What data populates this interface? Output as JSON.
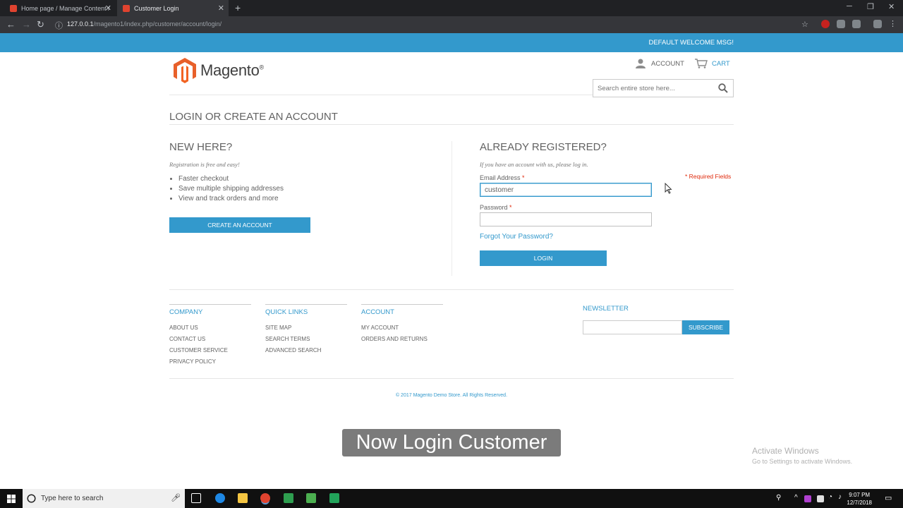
{
  "browser": {
    "tabs": [
      {
        "title": "Home page / Manage Content /"
      },
      {
        "title": "Customer Login"
      }
    ],
    "url_host": "127.0.0.1",
    "url_path": "/magento1/index.php/customer/account/login/"
  },
  "header": {
    "welcome": "DEFAULT WELCOME MSG!",
    "logo_text": "Magento",
    "account_label": "ACCOUNT",
    "cart_label": "CART",
    "search_placeholder": "Search entire store here..."
  },
  "page": {
    "title": "LOGIN OR CREATE AN ACCOUNT",
    "new_customer": {
      "heading": "NEW HERE?",
      "subtitle": "Registration is free and easy!",
      "benefits": [
        "Faster checkout",
        "Save multiple shipping addresses",
        "View and track orders and more"
      ],
      "button": "CREATE AN ACCOUNT"
    },
    "registered": {
      "heading": "ALREADY REGISTERED?",
      "subtitle": "If you have an account with us, please log in.",
      "required_note": "* Required Fields",
      "email_label": "Email Address",
      "email_value": "customer",
      "password_label": "Password",
      "required_mark": "*",
      "forgot_link": "Forgot Your Password?",
      "login_button": "LOGIN"
    }
  },
  "footer": {
    "columns": [
      {
        "title": "COMPANY",
        "links": [
          "ABOUT US",
          "CONTACT US",
          "CUSTOMER SERVICE",
          "PRIVACY POLICY"
        ]
      },
      {
        "title": "QUICK LINKS",
        "links": [
          "SITE MAP",
          "SEARCH TERMS",
          "ADVANCED SEARCH"
        ]
      },
      {
        "title": "ACCOUNT",
        "links": [
          "MY ACCOUNT",
          "ORDERS AND RETURNS"
        ]
      }
    ],
    "newsletter_title": "NEWSLETTER",
    "subscribe_button": "SUBSCRIBE",
    "copyright": "© 2017 Magento Demo Store. All Rights Reserved."
  },
  "overlay": {
    "caption": "Now Login Customer",
    "activate_title": "Activate Windows",
    "activate_sub": "Go to Settings to activate Windows."
  },
  "taskbar": {
    "search_text": "Type here to search",
    "time": "9:07 PM",
    "date": "12/7/2018"
  },
  "colors": {
    "accent": "#3399cc",
    "required": "#df280a",
    "logo_orange": "#e8602a"
  }
}
